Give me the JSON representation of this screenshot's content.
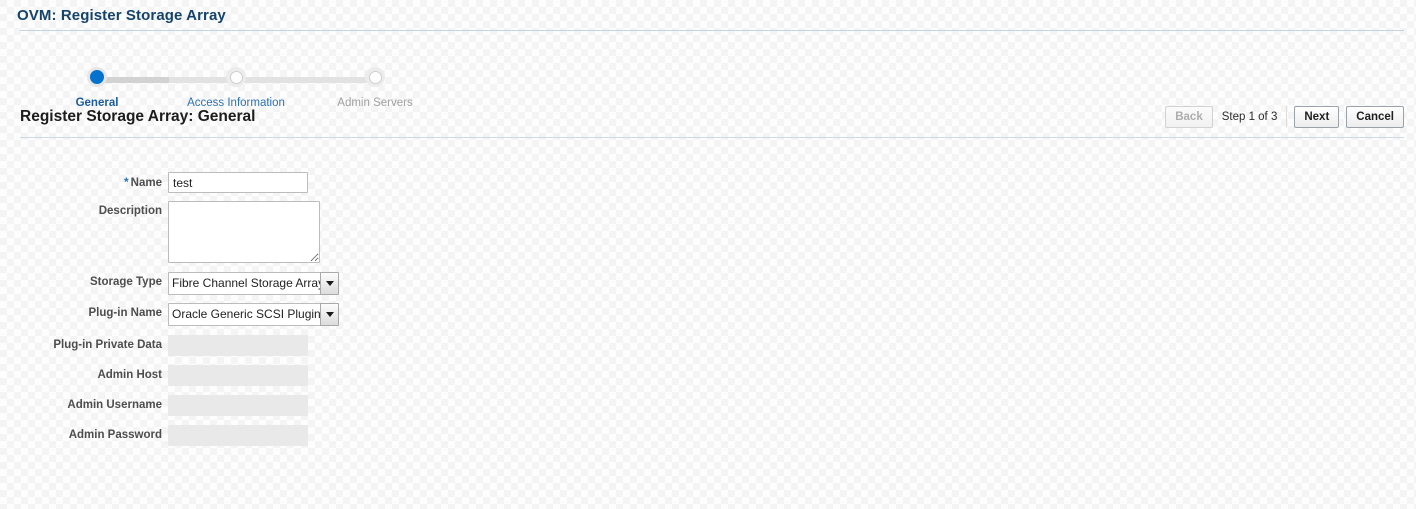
{
  "app": {
    "title": "OVM: Register Storage Array"
  },
  "train": {
    "steps": [
      {
        "label": "General",
        "state": "active"
      },
      {
        "label": "Access Information",
        "state": "todo"
      },
      {
        "label": "Admin Servers",
        "state": "disabled"
      }
    ]
  },
  "page_header": {
    "title": "Register Storage Array: General",
    "back_label": "Back",
    "step_indicator": "Step 1 of 3",
    "next_label": "Next",
    "cancel_label": "Cancel"
  },
  "form": {
    "name": {
      "label": "Name",
      "required_marker": "*",
      "value": "test",
      "placeholder": ""
    },
    "description": {
      "label": "Description",
      "value": "",
      "placeholder": ""
    },
    "storage_type": {
      "label": "Storage Type",
      "value": "Fibre Channel Storage Array"
    },
    "plugin_name": {
      "label": "Plug-in Name",
      "value": "Oracle Generic SCSI Plugin"
    },
    "plugin_private_data": {
      "label": "Plug-in Private Data",
      "value": ""
    },
    "admin_host": {
      "label": "Admin Host",
      "value": ""
    },
    "admin_username": {
      "label": "Admin Username",
      "value": ""
    },
    "admin_password": {
      "label": "Admin Password",
      "value": ""
    }
  },
  "colors": {
    "app_title": "#14436b",
    "link": "#2a72b5",
    "active_step": "#0572ce",
    "disabled_text": "#a0a0a0"
  }
}
